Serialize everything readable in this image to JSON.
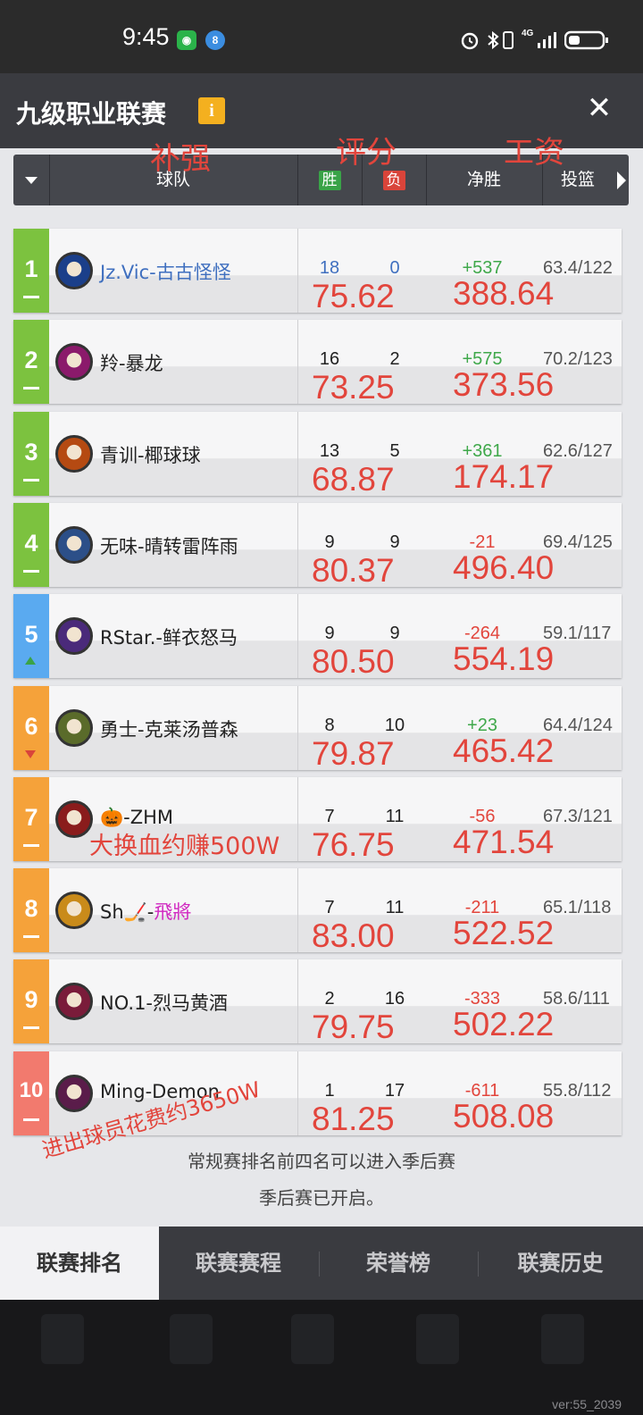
{
  "status_bar": {
    "time": "9:45",
    "network": "4G"
  },
  "header": {
    "title": "九级职业联赛",
    "info_icon": "i",
    "close_icon": "✕"
  },
  "columns": {
    "team": "球队",
    "win": "胜",
    "loss": "负",
    "net": "净胜",
    "shooting": "投篮"
  },
  "annotations": {
    "boost": "补强",
    "rating": "评分",
    "salary": "工资",
    "note_row7": "大换血约赚500W",
    "note_bottom": "进出球员花费约3650W"
  },
  "colors": {
    "rank_green": "#7cc23f",
    "rank_blue": "#5aaaf0",
    "rank_orange": "#f5a23a",
    "rank_red": "#f27a6e",
    "annotation_red": "#e2453c",
    "net_positive": "#3fa84a",
    "net_negative": "#e2453c",
    "team_blue": "#3f6fbf",
    "team_magenta": "#d026c0"
  },
  "teams": [
    {
      "rank": "1",
      "name": "Jz.Vic-古古怪怪",
      "wins": "18",
      "losses": "0",
      "net": "+537",
      "shooting": "63.4/122",
      "rating": "75.62",
      "salary": "388.64",
      "trend": "same",
      "rank_color": "green",
      "name_color": "blue",
      "net_sign": "positive"
    },
    {
      "rank": "2",
      "name": "羚-暴龙",
      "wins": "16",
      "losses": "2",
      "net": "+575",
      "shooting": "70.2/123",
      "rating": "73.25",
      "salary": "373.56",
      "trend": "same",
      "rank_color": "green",
      "net_sign": "positive"
    },
    {
      "rank": "3",
      "name": "青训-椰球球",
      "wins": "13",
      "losses": "5",
      "net": "+361",
      "shooting": "62.6/127",
      "rating": "68.87",
      "salary": "174.17",
      "trend": "same",
      "rank_color": "green",
      "net_sign": "positive"
    },
    {
      "rank": "4",
      "name": "无味-晴转雷阵雨",
      "wins": "9",
      "losses": "9",
      "net": "-21",
      "shooting": "69.4/125",
      "rating": "80.37",
      "salary": "496.40",
      "trend": "same",
      "rank_color": "green",
      "net_sign": "negative"
    },
    {
      "rank": "5",
      "name": "RStar.-鲜衣怒马",
      "wins": "9",
      "losses": "9",
      "net": "-264",
      "shooting": "59.1/117",
      "rating": "80.50",
      "salary": "554.19",
      "trend": "up",
      "rank_color": "blue",
      "net_sign": "negative"
    },
    {
      "rank": "6",
      "name": "勇士-克莱汤普森",
      "wins": "8",
      "losses": "10",
      "net": "+23",
      "shooting": "64.4/124",
      "rating": "79.87",
      "salary": "465.42",
      "trend": "down",
      "rank_color": "orange",
      "net_sign": "positive"
    },
    {
      "rank": "7",
      "name": "🎃-ZHM",
      "wins": "7",
      "losses": "11",
      "net": "-56",
      "shooting": "67.3/121",
      "rating": "76.75",
      "salary": "471.54",
      "trend": "same",
      "rank_color": "orange",
      "net_sign": "negative"
    },
    {
      "rank": "8",
      "name_prefix": "Sh🏒-",
      "name_suffix": "飛將",
      "wins": "7",
      "losses": "11",
      "net": "-211",
      "shooting": "65.1/118",
      "rating": "83.00",
      "salary": "522.52",
      "trend": "same",
      "rank_color": "orange",
      "net_sign": "negative"
    },
    {
      "rank": "9",
      "name": "NO.1-烈马黄酒",
      "wins": "2",
      "losses": "16",
      "net": "-333",
      "shooting": "58.6/111",
      "rating": "79.75",
      "salary": "502.22",
      "trend": "same",
      "rank_color": "orange",
      "net_sign": "negative"
    },
    {
      "rank": "10",
      "name": "Ming-Demon",
      "wins": "1",
      "losses": "17",
      "net": "-611",
      "shooting": "55.8/112",
      "rating": "81.25",
      "salary": "508.08",
      "trend": "same",
      "rank_color": "red",
      "net_sign": "negative"
    }
  ],
  "footer": {
    "line1": "常规赛排名前四名可以进入季后赛",
    "line2": "季后赛已开启。"
  },
  "tabs": [
    "联赛排名",
    "联赛赛程",
    "荣誉榜",
    "联赛历史"
  ],
  "active_tab": 0,
  "version": "ver:55_2039"
}
